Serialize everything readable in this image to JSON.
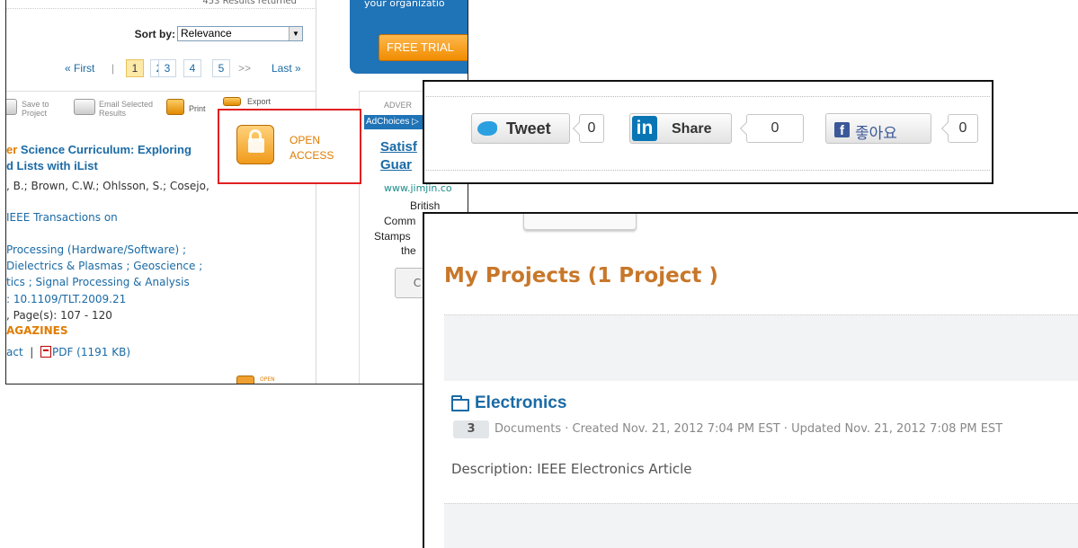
{
  "search_panel": {
    "results_returned": "453 Results returned",
    "sort_label": "Sort by:",
    "sort_value": "Relevance",
    "pager": {
      "first": "« First",
      "pages": [
        "1",
        "2",
        "3",
        "4",
        "5"
      ],
      "next": ">>",
      "last": "Last »"
    },
    "toolbar": {
      "save": [
        "Save to",
        "Project"
      ],
      "email": [
        "Email Selected",
        "Results"
      ],
      "print": "Print",
      "export": "Export"
    },
    "article": {
      "title_prefix": "er ",
      "title_line1": "Science Curriculum: Exploring",
      "title_line2": "d Lists with iList",
      "authors": ", B.; Brown, C.W.; Ohlsson, S.; Cosejo,",
      "journal": " IEEE Transactions on",
      "topics_1": "Processing (Hardware/Software) ;",
      "topics_2": "Dielectrics & Plasmas ; Geoscience ;",
      "topics_3": "tics ; Signal Processing & Analysis",
      "doi": ": 10.1109/TLT.2009.21",
      "pages": ", Page(s): 107 - 120",
      "magazines": "AGAZINES",
      "abstract": "act",
      "separator": "|",
      "pdf": "PDF (1191 KB)"
    },
    "open_small": "OPEN"
  },
  "ad_panel": {
    "org_text": "your organizatio",
    "free_trial": "FREE TRIAL",
    "advertisement": "ADVER",
    "adchoices": "AdChoices ▷",
    "link_line1": "Satisf",
    "link_line2": "Guar",
    "url": "www.jimjin.co",
    "body": [
      "British",
      "Comm",
      "Stamps",
      "the"
    ],
    "button": "C"
  },
  "open_access": {
    "line1": "OPEN",
    "line2": "ACCESS"
  },
  "social": {
    "tweet_label": "Tweet",
    "tweet_count": "0",
    "share_label": "Share",
    "linkedin_logo": "in",
    "share_count": "0",
    "like_label": "좋아요",
    "facebook_logo": "f",
    "like_count": "0"
  },
  "projects": {
    "heading": "My Projects (1 Project )",
    "project_name": "Electronics",
    "doc_count": "3",
    "meta": "Documents · Created Nov. 21, 2012 7:04 PM EST · Updated Nov. 21, 2012 7:08 PM EST",
    "description": "Description: IEEE Electronics Article"
  }
}
